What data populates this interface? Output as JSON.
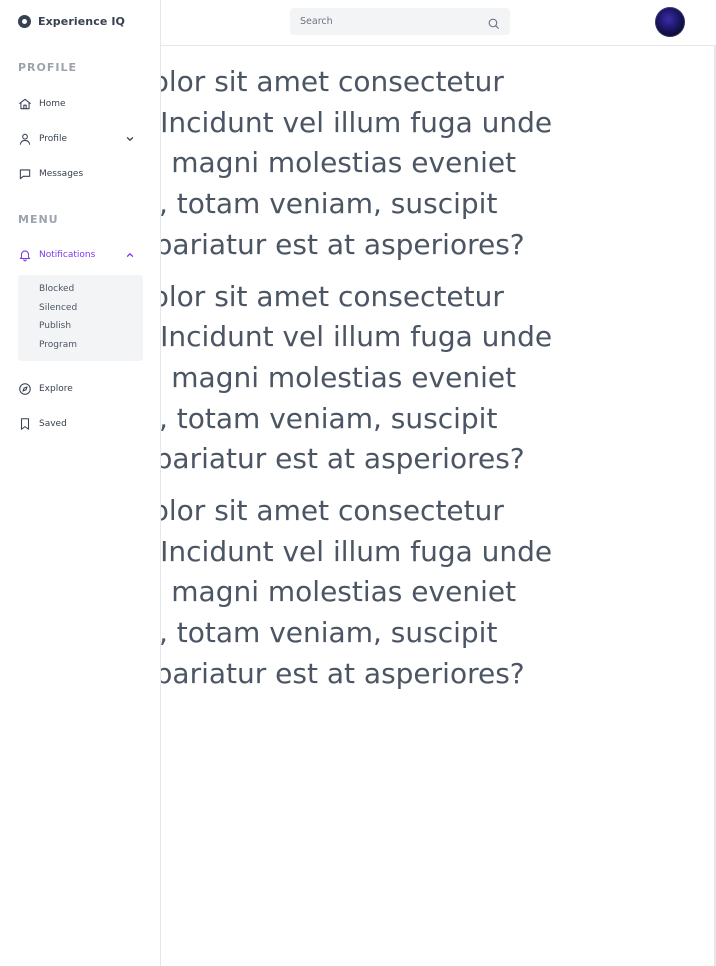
{
  "brand": {
    "name": "Experience IQ"
  },
  "sidebar": {
    "sections": [
      {
        "title": "PROFILE"
      },
      {
        "title": "MENU"
      }
    ],
    "items": [
      {
        "label": "Home",
        "icon": "home-icon"
      },
      {
        "label": "Profile",
        "icon": "user-icon"
      },
      {
        "label": "Messages",
        "icon": "chat-icon"
      },
      {
        "label": "Notifications",
        "icon": "bell-icon"
      },
      {
        "label": "Explore",
        "icon": "compass-icon"
      },
      {
        "label": "Saved",
        "icon": "bookmark-icon"
      }
    ],
    "notifications_submenu": [
      {
        "label": "Blocked"
      },
      {
        "label": "Silenced"
      },
      {
        "label": "Publish"
      },
      {
        "label": "Program"
      }
    ]
  },
  "search": {
    "placeholder": "Search"
  },
  "colors": {
    "accent": "#7c3aed",
    "text": "#4b5563"
  },
  "content": {
    "paragraphs": [
      {
        "lines": [
          "ipsum, dolor sit amet consectetur",
          "cing elit. Incidunt vel illum fuga unde",
          "oluptates magni molestias eveniet",
          "autem ut, totam veniam, suscipit",
          "re ullam pariatur est at asperiores?"
        ]
      },
      {
        "lines": [
          "ipsum, dolor sit amet consectetur",
          "cing elit. Incidunt vel illum fuga unde",
          "oluptates magni molestias eveniet",
          "autem ut, totam veniam, suscipit",
          "re ullam pariatur est at asperiores?"
        ]
      },
      {
        "lines": [
          "ipsum, dolor sit amet consectetur",
          "cing elit. Incidunt vel illum fuga unde",
          "oluptates magni molestias eveniet",
          "autem ut, totam veniam, suscipit",
          "re ullam pariatur est at asperiores?"
        ]
      }
    ]
  }
}
